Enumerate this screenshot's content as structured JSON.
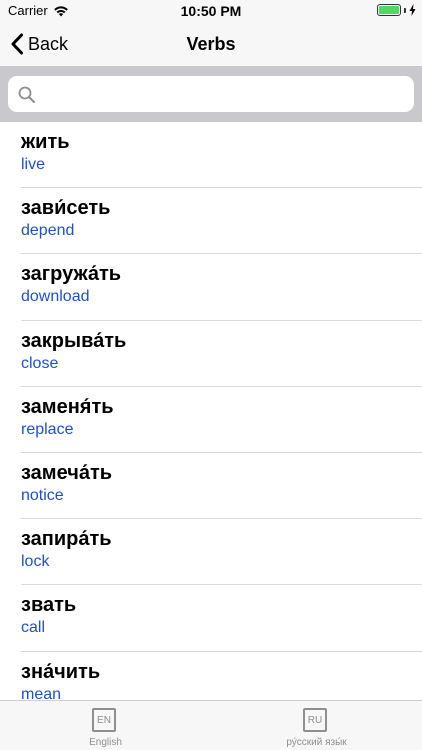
{
  "status_bar": {
    "carrier": "Carrier",
    "time": "10:50 PM",
    "battery_level": 1.0
  },
  "nav": {
    "back_label": "Back",
    "title": "Verbs"
  },
  "search": {
    "placeholder": "",
    "value": ""
  },
  "list": {
    "items": [
      {
        "word": "жить",
        "translation": "live"
      },
      {
        "word": "зави́сеть",
        "translation": "depend"
      },
      {
        "word": "загружа́ть",
        "translation": "download"
      },
      {
        "word": "закрыва́ть",
        "translation": "close"
      },
      {
        "word": "заменя́ть",
        "translation": "replace"
      },
      {
        "word": "замеча́ть",
        "translation": "notice"
      },
      {
        "word": "запира́ть",
        "translation": "lock"
      },
      {
        "word": "звать",
        "translation": "call"
      },
      {
        "word": "зна́чить",
        "translation": "mean"
      }
    ]
  },
  "tabs": [
    {
      "icon_text": "EN",
      "label": "English"
    },
    {
      "icon_text": "RU",
      "label": "ру́сский язы́к"
    }
  ],
  "colors": {
    "translation": "#1f4fcf",
    "battery": "#4cd964",
    "tab_inactive": "#8e8e93"
  }
}
